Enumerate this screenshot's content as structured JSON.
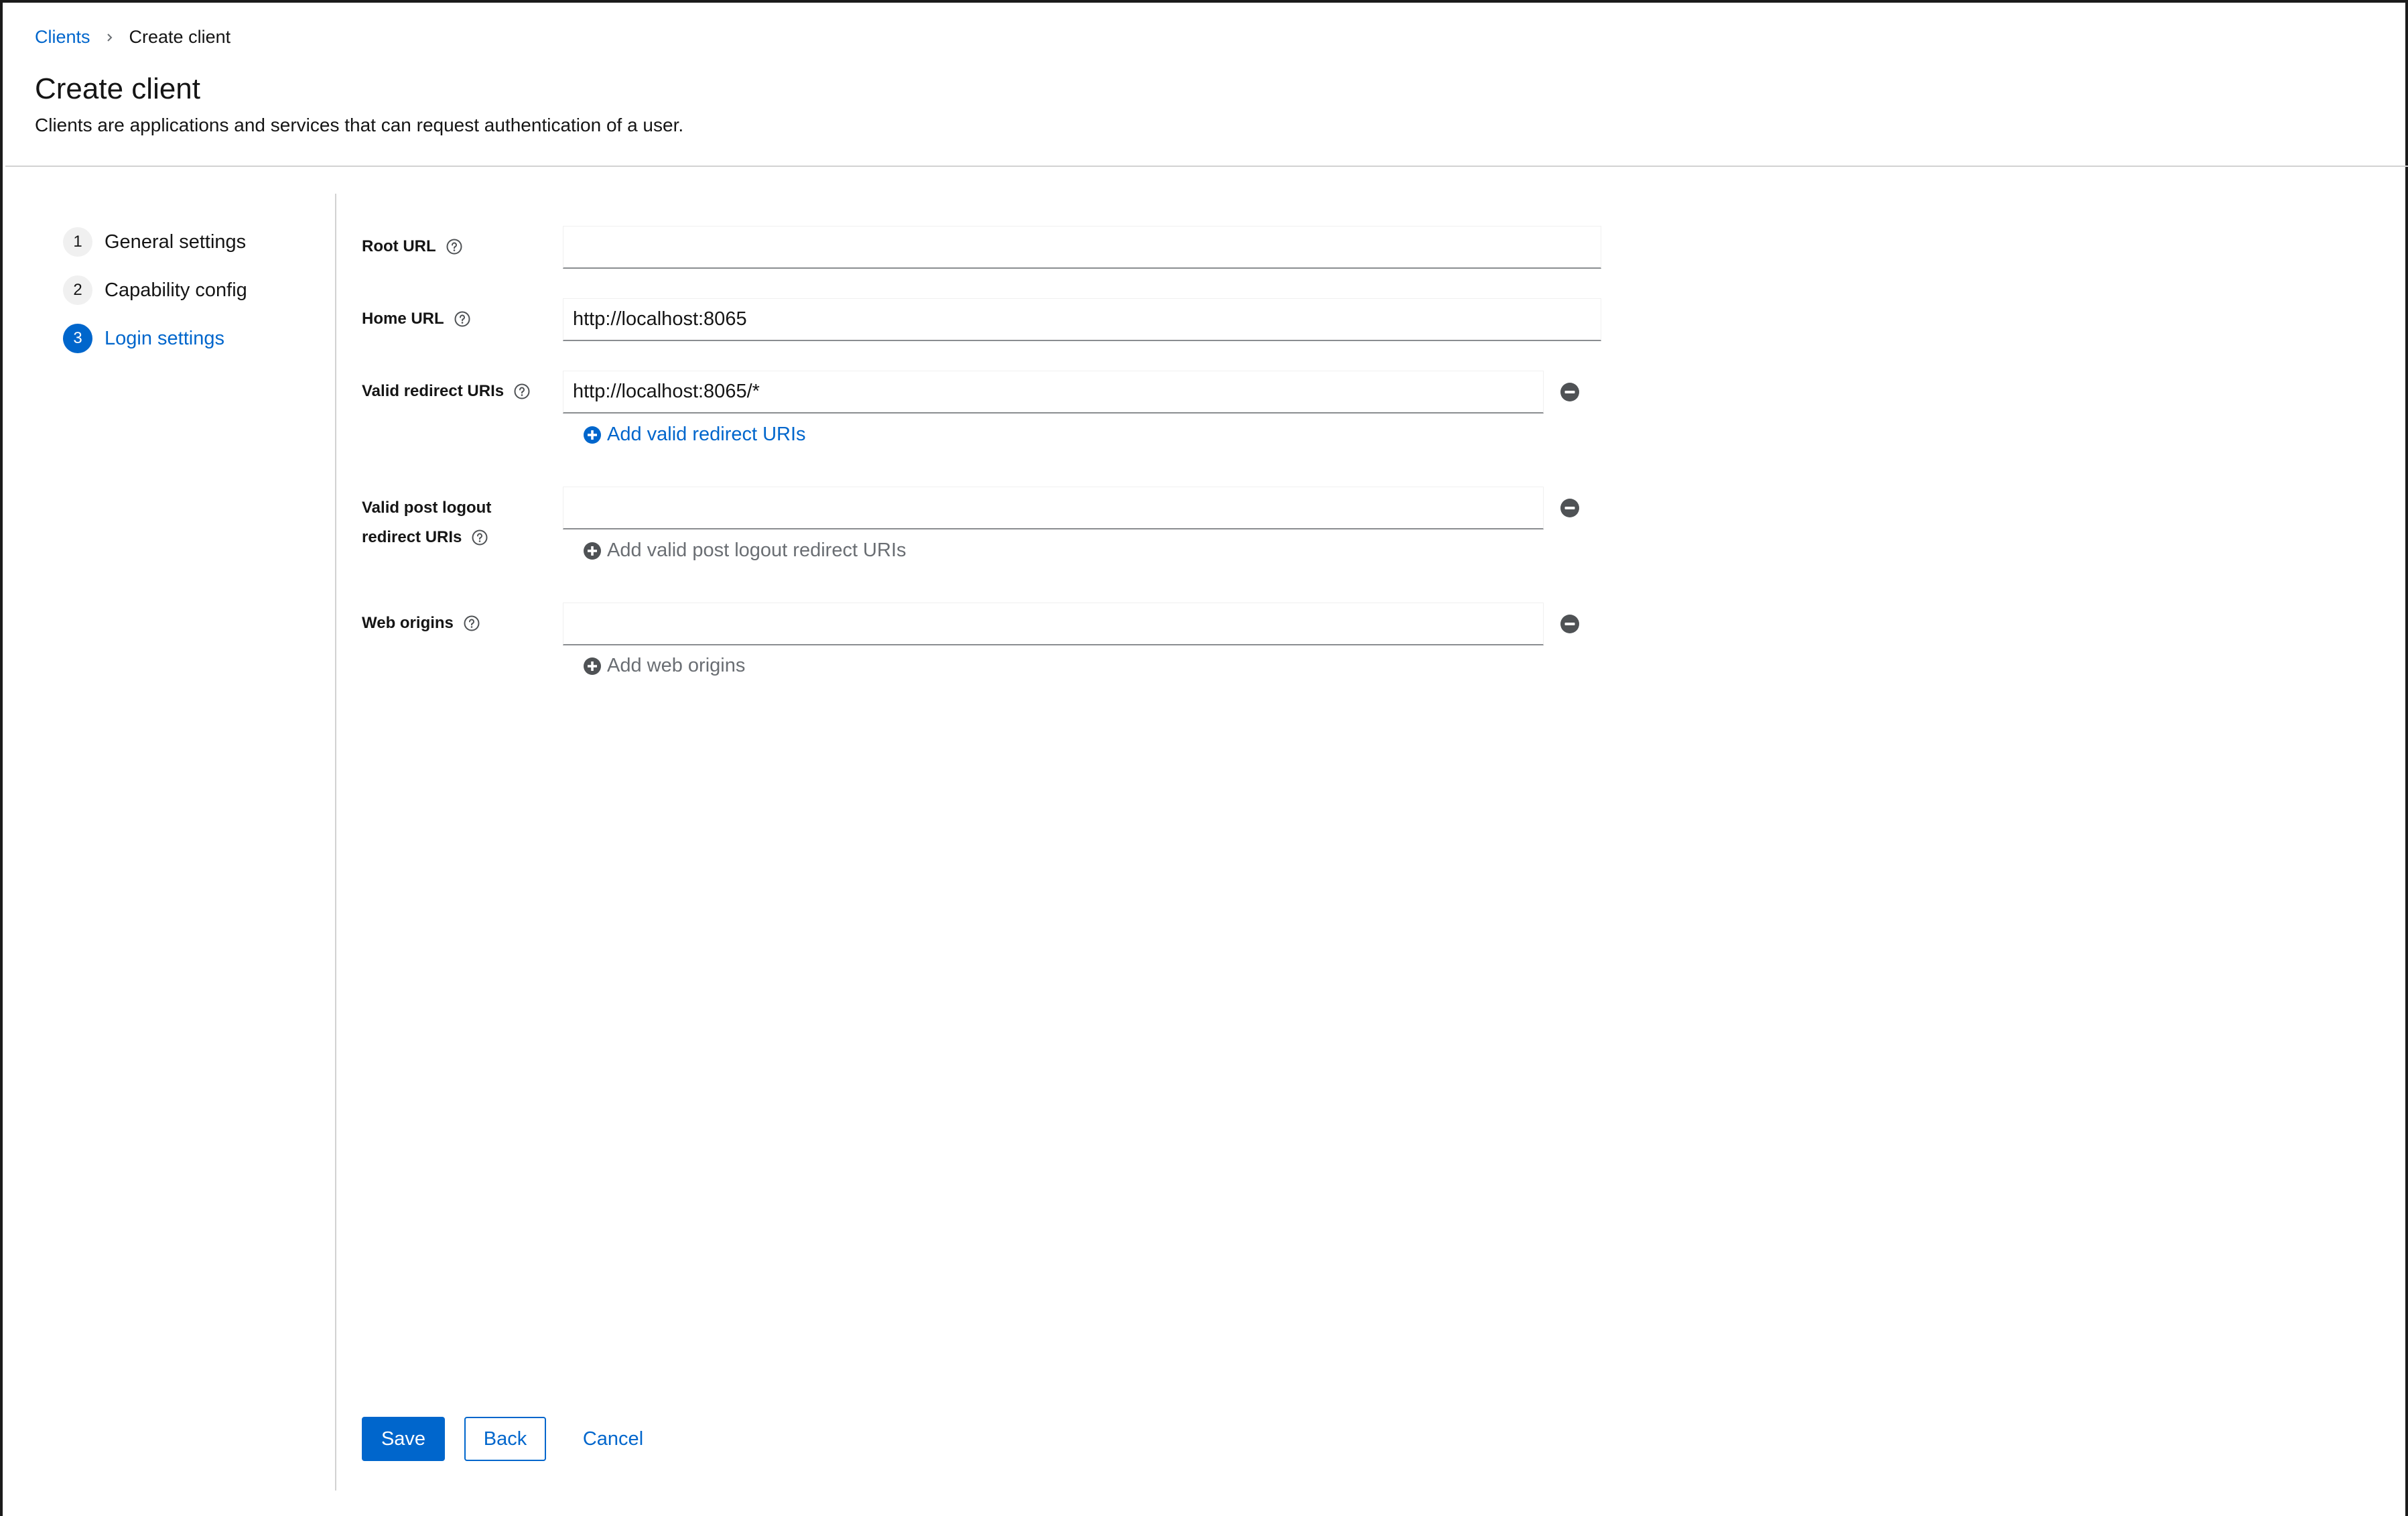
{
  "breadcrumb": {
    "parent": "Clients",
    "current": "Create client"
  },
  "page": {
    "title": "Create client",
    "description": "Clients are applications and services that can request authentication of a user."
  },
  "wizard": {
    "steps": [
      {
        "number": "1",
        "label": "General settings",
        "active": false
      },
      {
        "number": "2",
        "label": "Capability config",
        "active": false
      },
      {
        "number": "3",
        "label": "Login settings",
        "active": true
      }
    ]
  },
  "form": {
    "root_url": {
      "label": "Root URL",
      "value": ""
    },
    "home_url": {
      "label": "Home URL",
      "value": "http://localhost:8065"
    },
    "valid_redirect_uris": {
      "label": "Valid redirect URIs",
      "value": "http://localhost:8065/*",
      "add_label": "Add valid redirect URIs"
    },
    "valid_post_logout": {
      "label_line1": "Valid post logout",
      "label_line2": "redirect URIs",
      "value": "",
      "add_label": "Add valid post logout redirect URIs"
    },
    "web_origins": {
      "label": "Web origins",
      "value": "",
      "add_label": "Add web origins"
    }
  },
  "actions": {
    "save": "Save",
    "back": "Back",
    "cancel": "Cancel"
  },
  "colors": {
    "primary": "#0066cc",
    "text": "#151515",
    "muted": "#6a6e73",
    "border": "#d2d2d2"
  },
  "icons": {
    "help": "help-circle-icon",
    "remove": "minus-circle-icon",
    "add": "plus-circle-icon",
    "separator": "angle-right-icon"
  }
}
